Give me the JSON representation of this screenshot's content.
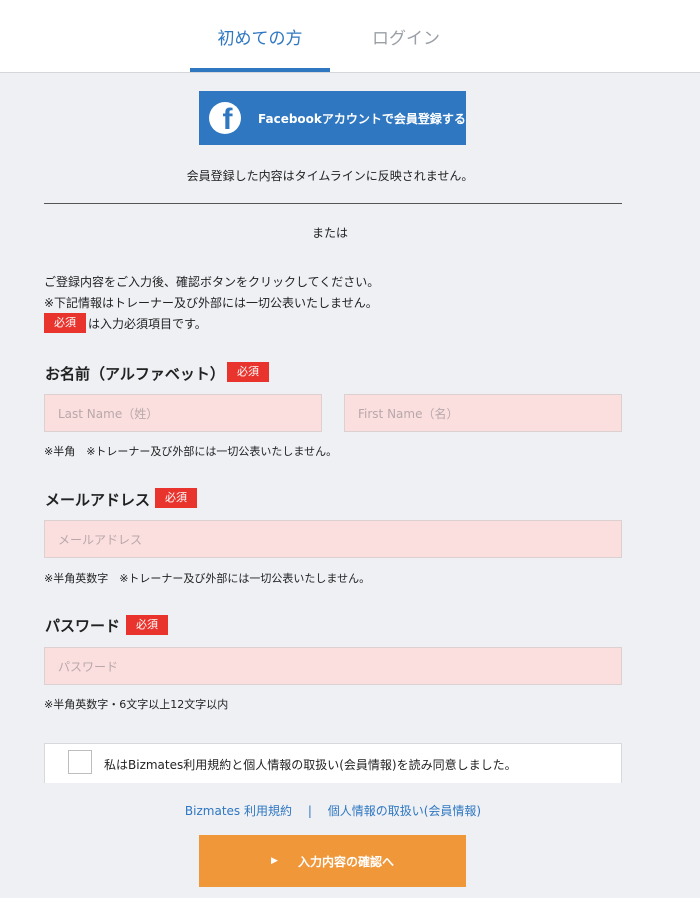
{
  "tabs": {
    "first_time": "初めての方",
    "login": "ログイン"
  },
  "facebook": {
    "label": "Facebookアカウントで会員登録する",
    "logo_letter": "f"
  },
  "fb_note": "会員登録した内容はタイムラインに反映されません。",
  "or_text": "または",
  "intro": {
    "line1": "ご登録内容をご入力後、確認ボタンをクリックしてください。",
    "line2": "※下記情報はトレーナー及び外部には一切公表いたしません。",
    "required_badge": "必須",
    "line3": "は入力必須項目です。"
  },
  "name_section": {
    "label": "お名前（アルファベット）",
    "badge": "必須",
    "last_placeholder": "Last Name（姓）",
    "first_placeholder": "First Name（名）",
    "hint": "※半角　※トレーナー及び外部には一切公表いたしません。"
  },
  "email_section": {
    "label": "メールアドレス",
    "badge": "必須",
    "placeholder": "メールアドレス",
    "hint": "※半角英数字　※トレーナー及び外部には一切公表いたしません。"
  },
  "password_section": {
    "label": "パスワード",
    "badge": "必須",
    "placeholder": "パスワード",
    "hint": "※半角英数字・6文字以上12文字以内"
  },
  "agreement": "私はBizmates利用規約と個人情報の取扱い(会員情報)を読み同意しました。",
  "links": {
    "terms": "Bizmates 利用規約",
    "separator": "|",
    "privacy": "個人情報の取扱い(会員情報)"
  },
  "confirm_button": {
    "arrow": "▶",
    "label": "入力内容の確認へ"
  },
  "colors": {
    "accent_blue": "#2f77c1",
    "required_red": "#e8342d",
    "confirm_orange": "#f0973a",
    "field_pink": "#fbdede"
  }
}
